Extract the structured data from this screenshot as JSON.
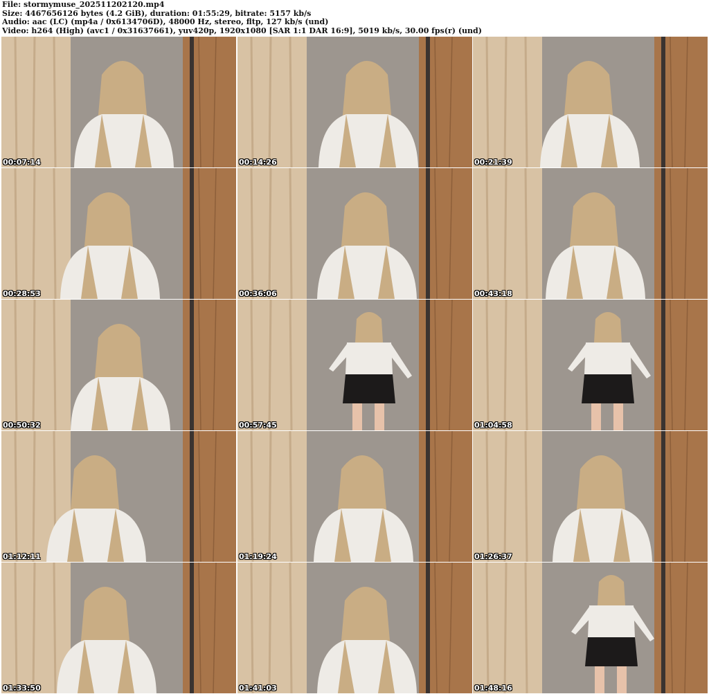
{
  "header": {
    "file": "File: stormymuse_202511202120.mp4",
    "size": "Size: 4467656126 bytes (4.2 GiB), duration: 01:55:29, bitrate: 5157 kb/s",
    "audio": "Audio: aac (LC) (mp4a / 0x6134706D), 48000 Hz, stereo, fltp, 127 kb/s (und)",
    "video": "Video: h264 (High) (avc1 / 0x31637661), yuv420p, 1920x1080 [SAR 1:1 DAR 16:9], 5019 kb/s, 30.00 fps(r) (und)"
  },
  "thumbnails": [
    {
      "time": "00:07:14",
      "pose": "seated"
    },
    {
      "time": "00:14:26",
      "pose": "seated"
    },
    {
      "time": "00:21:39",
      "pose": "seated"
    },
    {
      "time": "00:28:53",
      "pose": "seated"
    },
    {
      "time": "00:36:06",
      "pose": "seated"
    },
    {
      "time": "00:43:18",
      "pose": "seated"
    },
    {
      "time": "00:50:32",
      "pose": "seated"
    },
    {
      "time": "00:57:45",
      "pose": "standing"
    },
    {
      "time": "01:04:58",
      "pose": "standing"
    },
    {
      "time": "01:12:11",
      "pose": "seated"
    },
    {
      "time": "01:19:24",
      "pose": "seated"
    },
    {
      "time": "01:26:37",
      "pose": "seated"
    },
    {
      "time": "01:33:50",
      "pose": "seated"
    },
    {
      "time": "01:41:03",
      "pose": "seated"
    },
    {
      "time": "01:48:16",
      "pose": "standing"
    }
  ],
  "colors": {
    "curtain": "#d8c2a4",
    "wall": "#9d968f",
    "wood": "#a8754a",
    "shirt": "#eeebe6",
    "hair": "#c9ad84",
    "skin": "#e7c2aa",
    "skirt": "#1c1a1a"
  }
}
